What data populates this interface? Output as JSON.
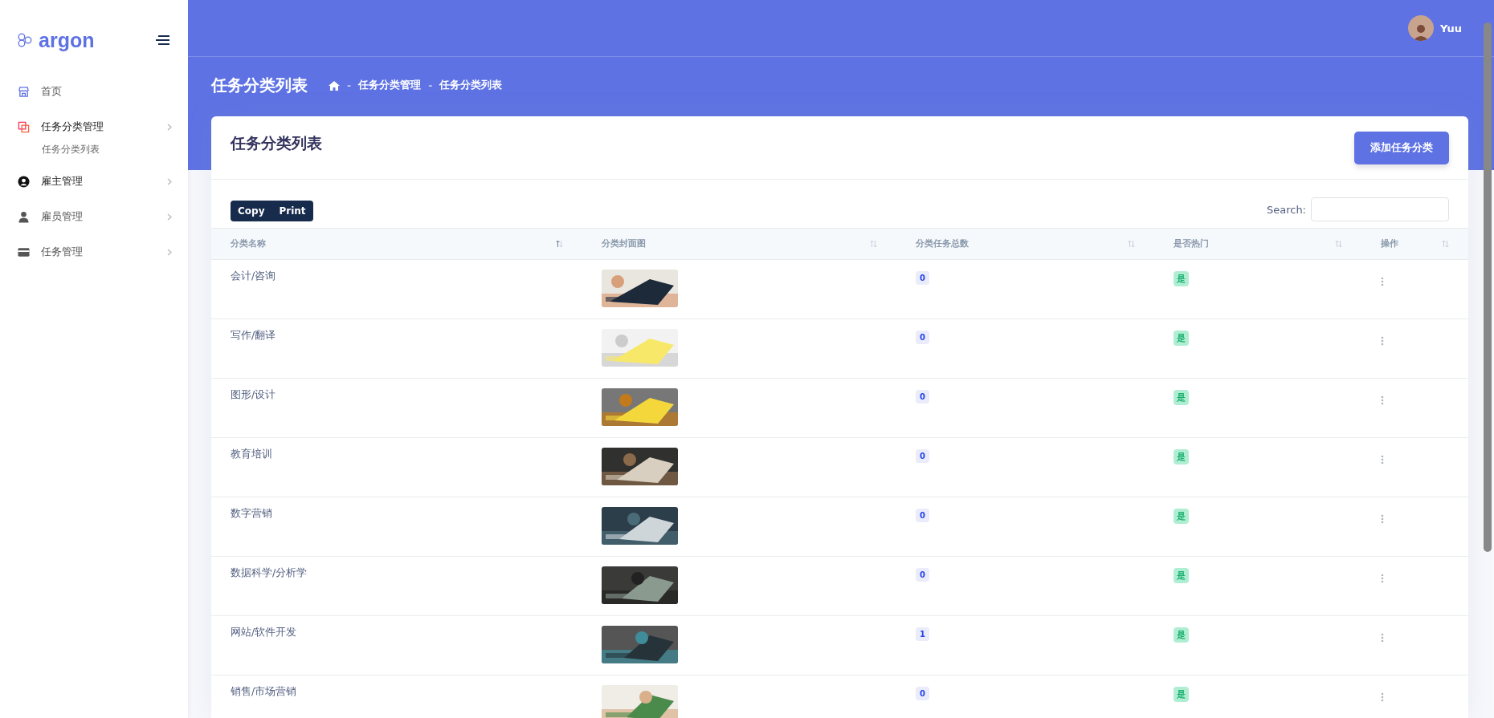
{
  "sidebar": {
    "logo": "argon",
    "items": [
      {
        "label": "首页"
      },
      {
        "label": "任务分类管理",
        "children": [
          {
            "label": "任务分类列表"
          }
        ]
      },
      {
        "label": "雇主管理"
      },
      {
        "label": "雇员管理"
      },
      {
        "label": "任务管理"
      }
    ]
  },
  "topbar": {
    "user": "Yuu"
  },
  "page_header": {
    "title": "任务分类列表",
    "breadcrumb_separator": "-",
    "breadcrumb": [
      "任务分类管理",
      "任务分类列表"
    ]
  },
  "card": {
    "title": "任务分类列表",
    "add_button": "添加任务分类",
    "export_buttons": [
      "Copy",
      "Print"
    ],
    "search": {
      "label": "Search:"
    }
  },
  "table": {
    "columns": [
      {
        "label": "分类名称",
        "sorted": true
      },
      {
        "label": "分类封面图",
        "sorted": false
      },
      {
        "label": "分类任务总数",
        "sorted": false
      },
      {
        "label": "是否热门",
        "sorted": false
      },
      {
        "label": "操作",
        "sorted": false
      }
    ],
    "rows": [
      {
        "name": "会计/咨询",
        "count": "0",
        "hot": "是"
      },
      {
        "name": "写作/翻译",
        "count": "0",
        "hot": "是"
      },
      {
        "name": "图形/设计",
        "count": "0",
        "hot": "是"
      },
      {
        "name": "教育培训",
        "count": "0",
        "hot": "是"
      },
      {
        "name": "数字营销",
        "count": "0",
        "hot": "是"
      },
      {
        "name": "数据科学/分析学",
        "count": "0",
        "hot": "是"
      },
      {
        "name": "网站/软件开发",
        "count": "1",
        "hot": "是"
      },
      {
        "name": "销售/市场营销",
        "count": "0",
        "hot": "是"
      }
    ]
  }
}
